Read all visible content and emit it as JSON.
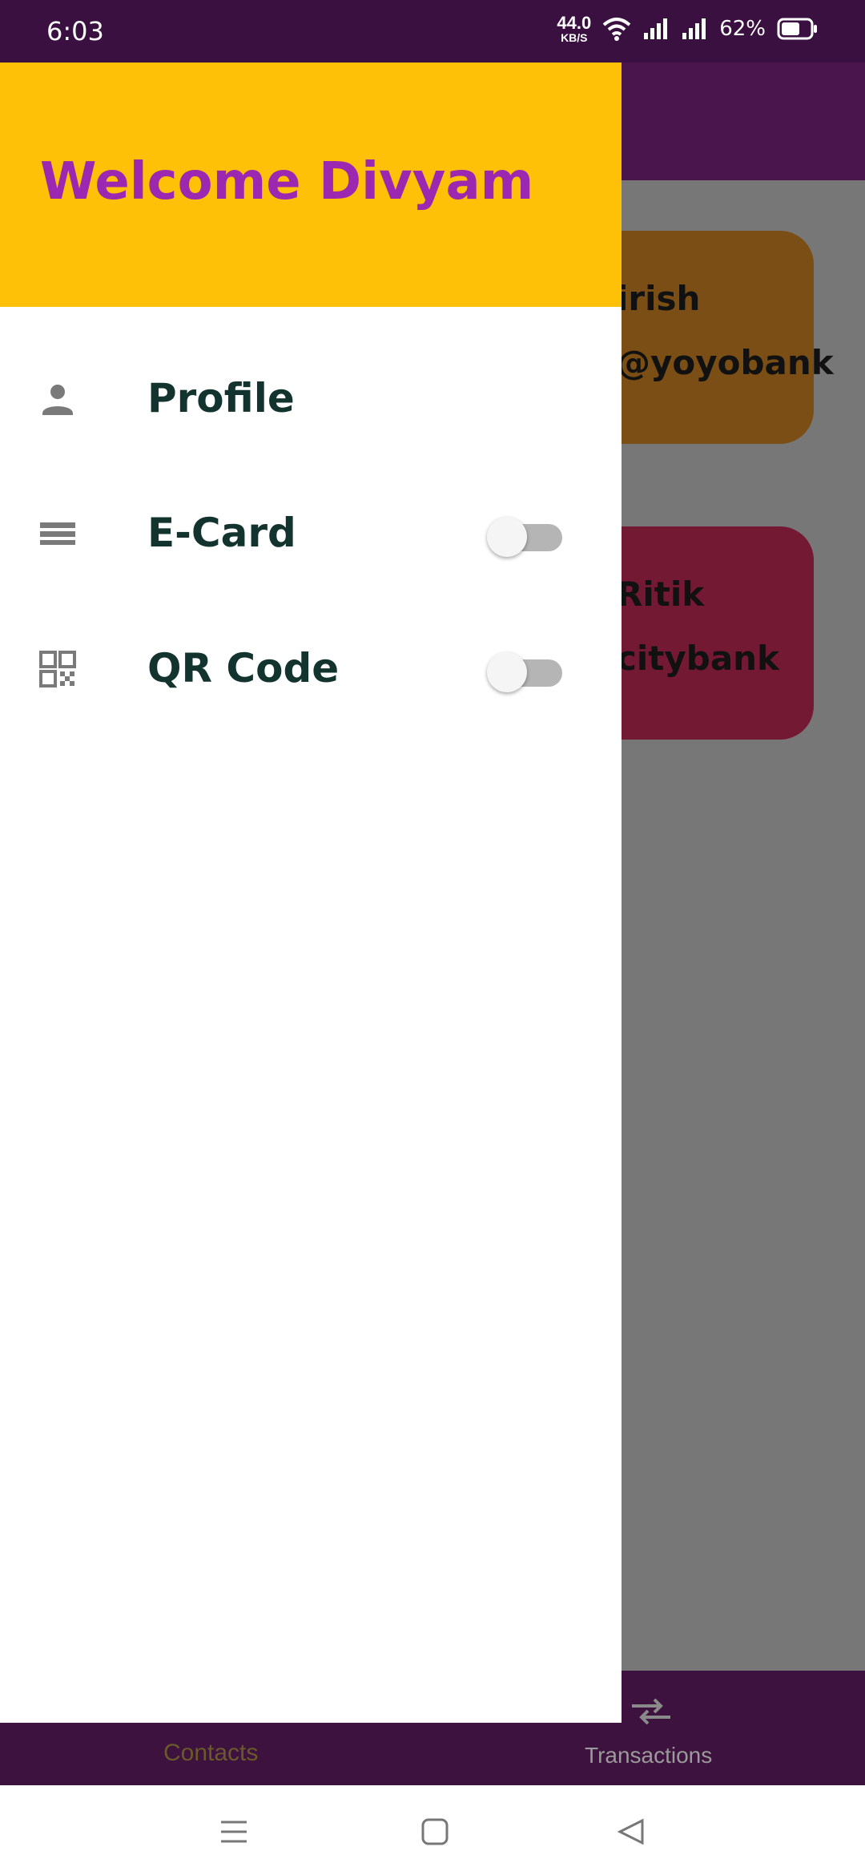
{
  "status_bar": {
    "time": "6:03",
    "speed_value": "44.0",
    "speed_unit": "KB/S",
    "battery": "62%"
  },
  "drawer": {
    "welcome": "Welcome Divyam",
    "items": [
      {
        "label": "Profile",
        "icon": "person-icon",
        "has_toggle": false
      },
      {
        "label": "E-Card",
        "icon": "card-icon",
        "has_toggle": true,
        "toggle_on": false
      },
      {
        "label": "QR Code",
        "icon": "qr-code-icon",
        "has_toggle": true,
        "toggle_on": false
      }
    ]
  },
  "background_cards": [
    {
      "line1": "irish",
      "line2": "@yoyobank",
      "color": "#7a4e14"
    },
    {
      "line1": "Ritik",
      "line2": "citybank",
      "color": "#731934"
    }
  ],
  "bottom_nav": {
    "contacts": "Contacts",
    "transactions": "Transactions"
  },
  "colors": {
    "header_yellow": "#ffc107",
    "welcome_purple": "#9c27b0",
    "status_bar": "#3a1040"
  }
}
